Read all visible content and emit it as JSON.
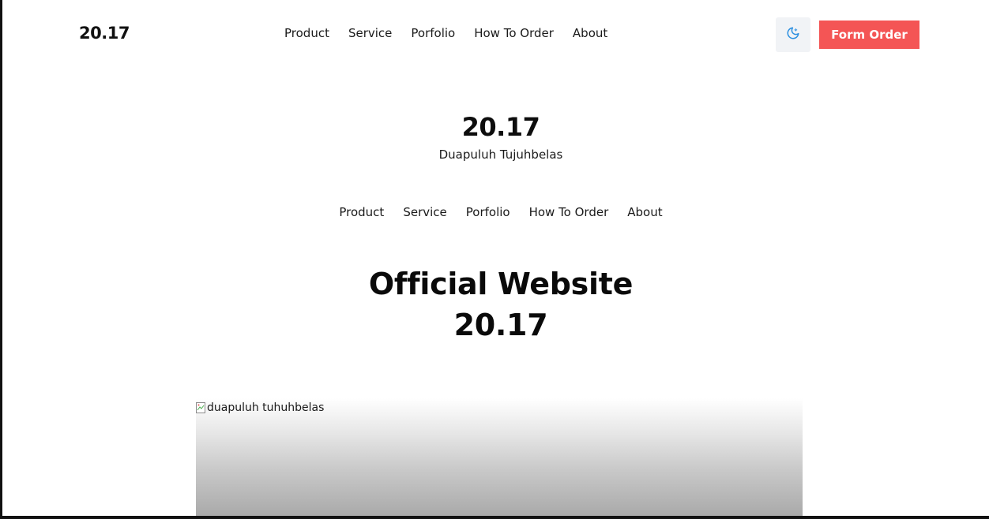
{
  "header": {
    "brand": "20.17",
    "nav": [
      "Product",
      "Service",
      "Porfolio",
      "How To Order",
      "About"
    ],
    "theme_toggle_icon": "moon-icon",
    "order_button": "Form Order",
    "accent_color": "#f45555",
    "icon_color": "#2b8fe0"
  },
  "hero": {
    "brand": "20.17",
    "subtitle": "Duapuluh Tujuhbelas",
    "nav": [
      "Product",
      "Service",
      "Porfolio",
      "How To Order",
      "About"
    ],
    "headline_line1": "Official Website",
    "headline_line2": "20.17",
    "image_alt": "duapuluh tuhuhbelas",
    "image_icon": "broken-image-icon"
  }
}
